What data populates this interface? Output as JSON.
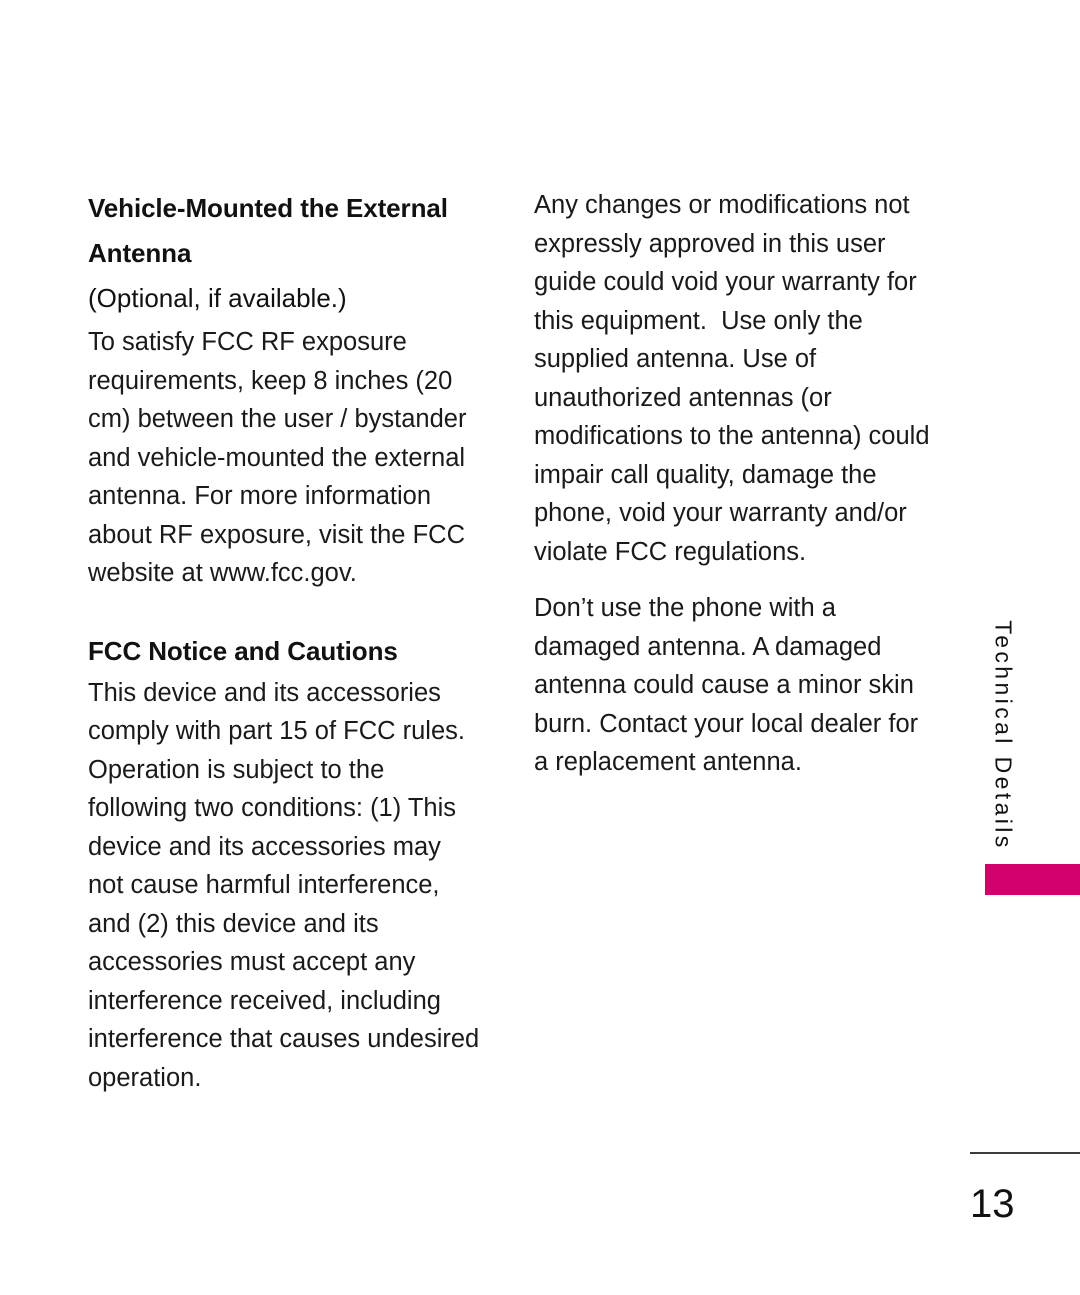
{
  "page": {
    "number": "13",
    "side_tab_label": "Technical Details",
    "accent_color": "#d4006e",
    "text_color": "#111111"
  },
  "left_column": {
    "heading": "Vehicle-Mounted the External Antenna",
    "subheading": "(Optional, if available.)",
    "paragraph_1": "To satisfy FCC RF exposure requirements, keep 8 inches (20 cm) between the user / bystander and vehicle-mounted the external antenna. For more information about RF exposure, visit the FCC website at www.fcc.gov.",
    "heading_2": "FCC Notice and Cautions",
    "paragraph_2": "This device and its accessories comply with part 15 of FCC rules. Operation is subject to the following two conditions: (1) This device and its accessories may not cause harmful interference, and (2) this device and its accessories must accept any interference received, including interference that causes undesired operation."
  },
  "right_column": {
    "paragraph_1": "Any changes or modifications not expressly approved in this user guide could void your warranty for this equipment.  Use only the supplied antenna. Use of unauthorized antennas (or modifications to the antenna) could impair call quality, damage the phone, void your warranty and/or violate FCC regulations.",
    "paragraph_2": "Don’t use the phone with a damaged antenna. A damaged antenna could cause a minor skin burn. Contact your local dealer for a replacement antenna."
  }
}
